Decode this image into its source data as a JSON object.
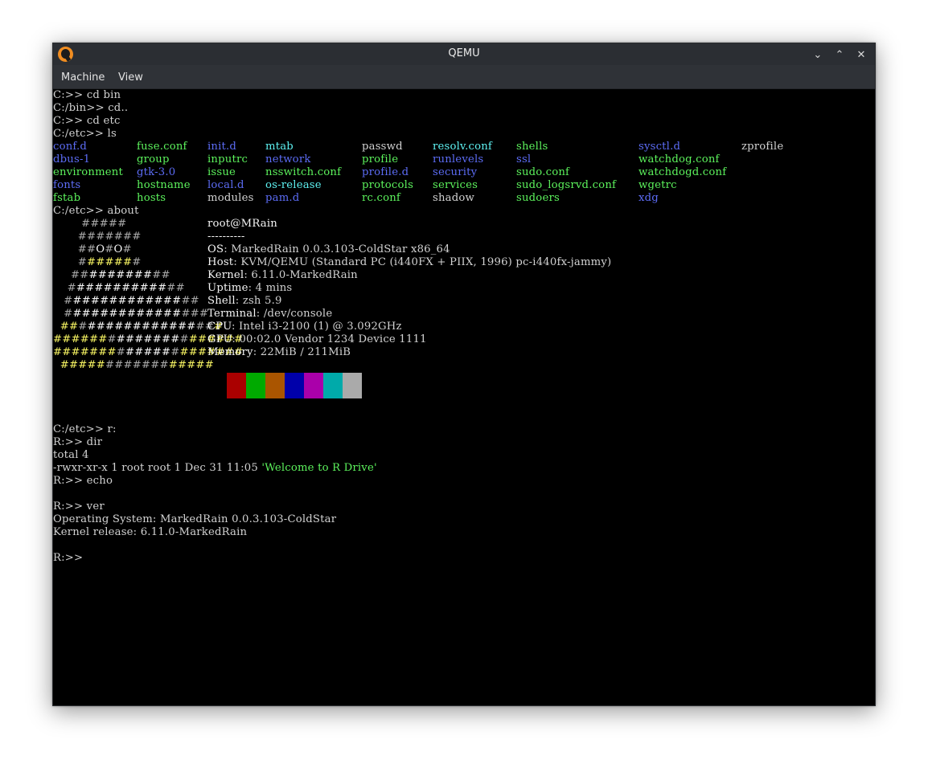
{
  "window": {
    "title": "QEMU",
    "controls": {
      "minimize": "⌄",
      "maximize": "⌃",
      "close": "✕"
    }
  },
  "menubar": {
    "items": [
      "Machine",
      "View"
    ]
  },
  "terminal": {
    "lines_top": [
      "C:>> cd bin",
      "C:/bin>> cd..",
      "C:>> cd etc",
      "C:/etc>> ls"
    ],
    "ls": [
      {
        "name": "conf.d",
        "color": "blue",
        "col": 0,
        "row": 0
      },
      {
        "name": "dbus-1",
        "color": "blue",
        "col": 0,
        "row": 1
      },
      {
        "name": "environment",
        "color": "green",
        "col": 0,
        "row": 2
      },
      {
        "name": "fonts",
        "color": "blue",
        "col": 0,
        "row": 3
      },
      {
        "name": "fstab",
        "color": "green",
        "col": 0,
        "row": 4
      },
      {
        "name": "fuse.conf",
        "color": "green",
        "col": 1,
        "row": 0
      },
      {
        "name": "group",
        "color": "green",
        "col": 1,
        "row": 1
      },
      {
        "name": "gtk-3.0",
        "color": "blue",
        "col": 1,
        "row": 2
      },
      {
        "name": "hostname",
        "color": "green",
        "col": 1,
        "row": 3
      },
      {
        "name": "hosts",
        "color": "green",
        "col": 1,
        "row": 4
      },
      {
        "name": "init.d",
        "color": "blue",
        "col": 2,
        "row": 0
      },
      {
        "name": "inputrc",
        "color": "green",
        "col": 2,
        "row": 1
      },
      {
        "name": "issue",
        "color": "green",
        "col": 2,
        "row": 2
      },
      {
        "name": "local.d",
        "color": "blue",
        "col": 2,
        "row": 3
      },
      {
        "name": "modules",
        "color": "white",
        "col": 2,
        "row": 4
      },
      {
        "name": "mtab",
        "color": "cyan",
        "col": 3,
        "row": 0
      },
      {
        "name": "network",
        "color": "blue",
        "col": 3,
        "row": 1
      },
      {
        "name": "nsswitch.conf",
        "color": "green",
        "col": 3,
        "row": 2
      },
      {
        "name": "os-release",
        "color": "cyan",
        "col": 3,
        "row": 3
      },
      {
        "name": "pam.d",
        "color": "blue",
        "col": 3,
        "row": 4
      },
      {
        "name": "passwd",
        "color": "white",
        "col": 4,
        "row": 0
      },
      {
        "name": "profile",
        "color": "green",
        "col": 4,
        "row": 1
      },
      {
        "name": "profile.d",
        "color": "blue",
        "col": 4,
        "row": 2
      },
      {
        "name": "protocols",
        "color": "green",
        "col": 4,
        "row": 3
      },
      {
        "name": "rc.conf",
        "color": "green",
        "col": 4,
        "row": 4
      },
      {
        "name": "resolv.conf",
        "color": "cyan",
        "col": 5,
        "row": 0
      },
      {
        "name": "runlevels",
        "color": "blue",
        "col": 5,
        "row": 1
      },
      {
        "name": "security",
        "color": "blue",
        "col": 5,
        "row": 2
      },
      {
        "name": "services",
        "color": "green",
        "col": 5,
        "row": 3
      },
      {
        "name": "shadow",
        "color": "white",
        "col": 5,
        "row": 4
      },
      {
        "name": "shells",
        "color": "green",
        "col": 6,
        "row": 0
      },
      {
        "name": "ssl",
        "color": "blue",
        "col": 6,
        "row": 1
      },
      {
        "name": "sudo.conf",
        "color": "green",
        "col": 6,
        "row": 2
      },
      {
        "name": "sudo_logsrvd.conf",
        "color": "green",
        "col": 6,
        "row": 3
      },
      {
        "name": "sudoers",
        "color": "green",
        "col": 6,
        "row": 4
      },
      {
        "name": "sysctl.d",
        "color": "blue",
        "col": 7,
        "row": 0
      },
      {
        "name": "watchdog.conf",
        "color": "green",
        "col": 7,
        "row": 1
      },
      {
        "name": "watchdogd.conf",
        "color": "green",
        "col": 7,
        "row": 2
      },
      {
        "name": "wgetrc",
        "color": "green",
        "col": 7,
        "row": 3
      },
      {
        "name": "xdg",
        "color": "blue",
        "col": 7,
        "row": 4
      },
      {
        "name": "zprofile",
        "color": "white",
        "col": 8,
        "row": 0
      }
    ],
    "about_cmd": "C:/etc>> about",
    "logo": [
      [
        {
          "t": "        #####",
          "c": "gray"
        }
      ],
      [
        {
          "t": "       #######",
          "c": "gray"
        }
      ],
      [
        {
          "t": "       ##",
          "c": "gray"
        },
        {
          "t": "O",
          "c": "bright"
        },
        {
          "t": "#",
          "c": "gray"
        },
        {
          "t": "O",
          "c": "bright"
        },
        {
          "t": "#",
          "c": "gray"
        }
      ],
      [
        {
          "t": "       #",
          "c": "gray"
        },
        {
          "t": "#####",
          "c": "yellow"
        },
        {
          "t": "#",
          "c": "gray"
        }
      ],
      [
        {
          "t": "     ##",
          "c": "gray"
        },
        {
          "t": "#######",
          "c": "bright"
        },
        {
          "t": "##",
          "c": "gray"
        }
      ],
      [
        {
          "t": "    #",
          "c": "gray"
        },
        {
          "t": "##########",
          "c": "bright"
        },
        {
          "t": "##",
          "c": "gray"
        }
      ],
      [
        {
          "t": "   #",
          "c": "gray"
        },
        {
          "t": "############",
          "c": "bright"
        },
        {
          "t": "##",
          "c": "gray"
        }
      ],
      [
        {
          "t": "   #",
          "c": "gray"
        },
        {
          "t": "############",
          "c": "bright"
        },
        {
          "t": "###",
          "c": "gray"
        }
      ],
      [
        {
          "t": "  ##",
          "c": "yellow"
        },
        {
          "t": "#",
          "c": "gray"
        },
        {
          "t": "############",
          "c": "bright"
        },
        {
          "t": "##",
          "c": "gray"
        },
        {
          "t": "#",
          "c": "yellow"
        }
      ],
      [
        {
          "t": "######",
          "c": "yellow"
        },
        {
          "t": "#",
          "c": "gray"
        },
        {
          "t": "#######",
          "c": "bright"
        },
        {
          "t": "#",
          "c": "gray"
        },
        {
          "t": "######",
          "c": "yellow"
        }
      ],
      [
        {
          "t": "#######",
          "c": "yellow"
        },
        {
          "t": "#",
          "c": "gray"
        },
        {
          "t": "#####",
          "c": "bright"
        },
        {
          "t": "#",
          "c": "gray"
        },
        {
          "t": "#######",
          "c": "yellow"
        }
      ],
      [
        {
          "t": "  #####",
          "c": "yellow"
        },
        {
          "t": "#######",
          "c": "gray"
        },
        {
          "t": "#####",
          "c": "yellow"
        }
      ]
    ],
    "sysinfo": [
      {
        "label": "root@MRain",
        "value": ""
      },
      {
        "label": "----------",
        "value": ""
      },
      {
        "label": "OS",
        "value": ": MarkedRain 0.0.3.103-ColdStar x86_64"
      },
      {
        "label": "Host",
        "value": ": KVM/QEMU (Standard PC (i440FX + PIIX, 1996) pc-i440fx-jammy)"
      },
      {
        "label": "Kernel",
        "value": ": 6.11.0-MarkedRain"
      },
      {
        "label": "Uptime",
        "value": ": 4 mins"
      },
      {
        "label": "Shell",
        "value": ": zsh 5.9"
      },
      {
        "label": "Terminal",
        "value": ": /dev/console"
      },
      {
        "label": "CPU",
        "value": ": Intel i3-2100 (1) @ 3.092GHz"
      },
      {
        "label": "GPU",
        "value": ": 00:02.0 Vendor 1234 Device 1111"
      },
      {
        "label": "Memory",
        "value": ": 22MiB / 211MiB"
      }
    ],
    "palette": [
      "#aa0000",
      "#00aa00",
      "#aa5500",
      "#0000aa",
      "#aa00aa",
      "#00aaaa",
      "#aaaaaa"
    ],
    "lines_bottom": [
      {
        "text": "C:/etc>> r:"
      },
      {
        "text": "R:>> dir"
      },
      {
        "text": "total 4"
      },
      {
        "text": "-rwxr-xr-x 1 root root 1 Dec 31 11:05 ",
        "highlight": "'Welcome to R Drive'"
      },
      {
        "text": "R:>> echo"
      },
      {
        "text": ""
      },
      {
        "text": "R:>> ver"
      },
      {
        "text": "Operating System: MarkedRain 0.0.3.103-ColdStar"
      },
      {
        "text": "Kernel release: 6.11.0-MarkedRain"
      },
      {
        "text": ""
      },
      {
        "text": "R:>>"
      }
    ]
  }
}
